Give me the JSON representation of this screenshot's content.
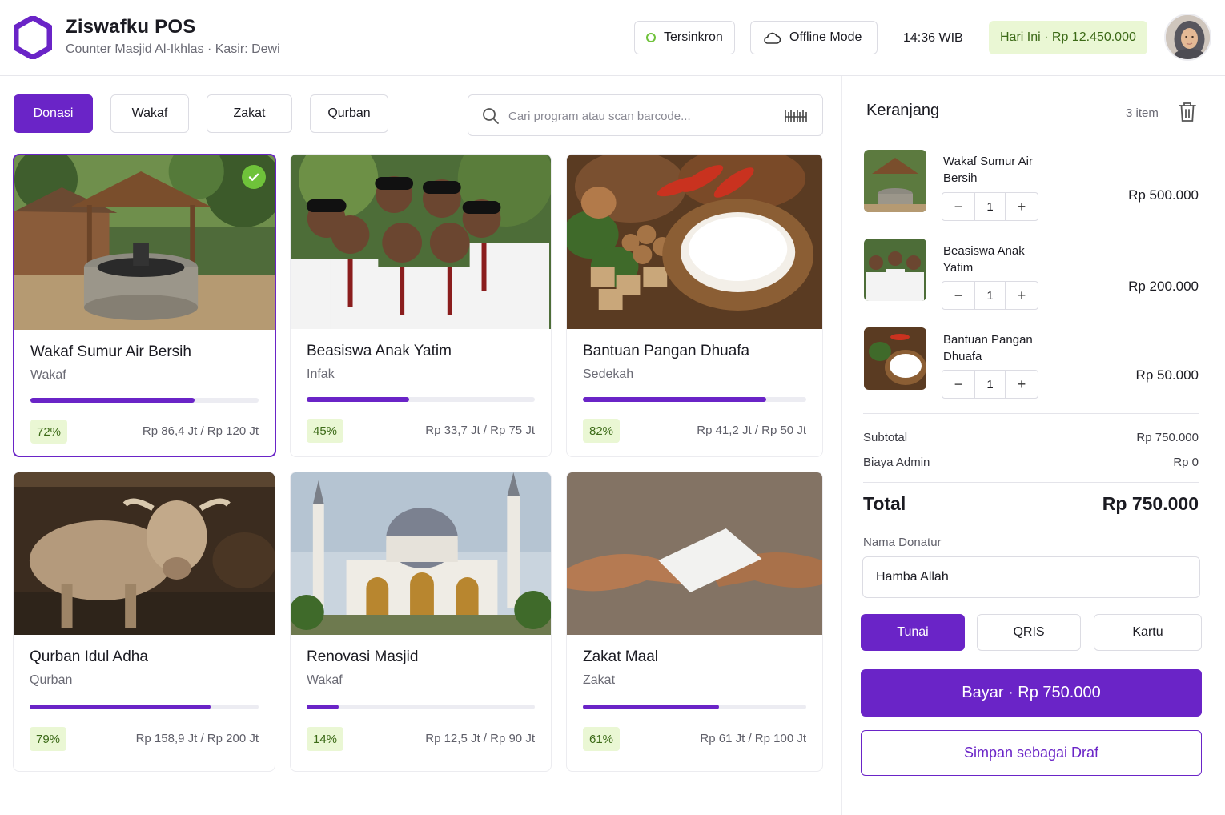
{
  "header": {
    "app_title": "Ziswafku POS",
    "subtitle": "Counter Masjid Al-Ikhlas · Kasir: Dewi",
    "sync_label": "Tersinkron",
    "offline_label": "Offline Mode",
    "time": "14:36 WIB",
    "today_total": "Hari Ini · Rp 12.450.000"
  },
  "tabs": [
    {
      "label": "Donasi",
      "active": true
    },
    {
      "label": "Wakaf",
      "active": false
    },
    {
      "label": "Zakat",
      "active": false
    },
    {
      "label": "Qurban",
      "active": false
    }
  ],
  "search": {
    "placeholder": "Cari program atau scan barcode..."
  },
  "programs": [
    {
      "title": "Wakaf Sumur Air Bersih",
      "category": "Wakaf",
      "progress": 72,
      "percent_label": "72%",
      "amount": "Rp 86,4 Jt / Rp 120 Jt",
      "selected": true
    },
    {
      "title": "Beasiswa Anak Yatim",
      "category": "Infak",
      "progress": 45,
      "percent_label": "45%",
      "amount": "Rp 33,7 Jt / Rp 75 Jt",
      "selected": false
    },
    {
      "title": "Bantuan Pangan Dhuafa",
      "category": "Sedekah",
      "progress": 82,
      "percent_label": "82%",
      "amount": "Rp 41,2 Jt / Rp 50 Jt",
      "selected": false
    },
    {
      "title": "Qurban Idul Adha",
      "category": "Qurban",
      "progress": 79,
      "percent_label": "79%",
      "amount": "Rp 158,9 Jt / Rp 200 Jt",
      "selected": false
    },
    {
      "title": "Renovasi Masjid",
      "category": "Wakaf",
      "progress": 14,
      "percent_label": "14%",
      "amount": "Rp 12,5 Jt / Rp 90 Jt",
      "selected": false
    },
    {
      "title": "Zakat Maal",
      "category": "Zakat",
      "progress": 61,
      "percent_label": "61%",
      "amount": "Rp 61 Jt / Rp 100 Jt",
      "selected": false
    }
  ],
  "cart": {
    "title": "Keranjang",
    "count": "3 item",
    "items": [
      {
        "name": "Wakaf Sumur Air Bersih",
        "qty": "1",
        "price": "Rp 500.000"
      },
      {
        "name": "Beasiswa Anak Yatim",
        "qty": "1",
        "price": "Rp 200.000"
      },
      {
        "name": "Bantuan Pangan Dhuafa",
        "qty": "1",
        "price": "Rp 50.000"
      }
    ],
    "subtotal_label": "Subtotal",
    "subtotal": "Rp 750.000",
    "admin_label": "Biaya Admin",
    "admin": "Rp 0",
    "total_label": "Total",
    "total": "Rp 750.000",
    "donor_label": "Nama Donatur",
    "donor_value": "Hamba Allah",
    "payment_methods": [
      {
        "label": "Tunai",
        "active": true
      },
      {
        "label": "QRIS",
        "active": false
      },
      {
        "label": "Kartu",
        "active": false
      }
    ],
    "pay_button": "Bayar · Rp 750.000",
    "draft_button": "Simpan sebagai Draf"
  },
  "colors": {
    "accent": "#6a24c7",
    "success": "#6fc23a",
    "badge_bg": "#eaf7d4",
    "badge_text": "#3c6a17"
  }
}
